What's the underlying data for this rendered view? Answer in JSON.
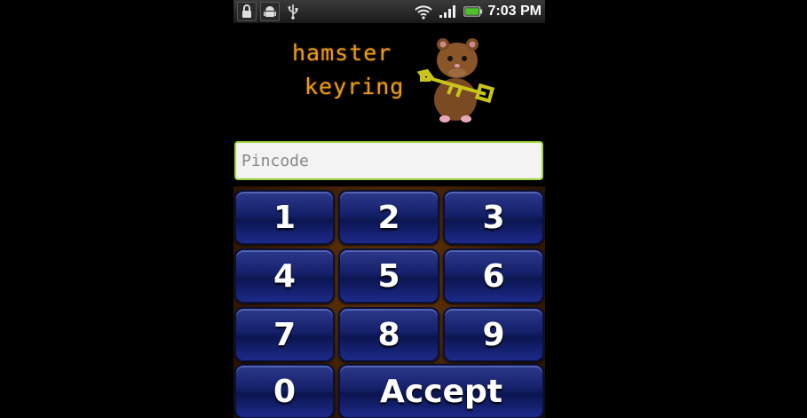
{
  "status_bar": {
    "time": "7:03 PM",
    "left_icons": [
      "lock-icon",
      "android-icon",
      "usb-icon"
    ],
    "right_icons": [
      "wifi-icon",
      "signal-icon",
      "battery-icon"
    ]
  },
  "logo": {
    "line1": "hamster",
    "line2": "keyring"
  },
  "pin_field": {
    "placeholder": "Pincode",
    "value": ""
  },
  "keypad": {
    "keys": [
      "1",
      "2",
      "3",
      "4",
      "5",
      "6",
      "7",
      "8",
      "9",
      "0"
    ],
    "accept_label": "Accept"
  },
  "colors": {
    "logo_text": "#e89a1c",
    "input_border": "#9ad23a",
    "key_blue": "#15206a",
    "keypad_bg": "#3a1d04"
  }
}
